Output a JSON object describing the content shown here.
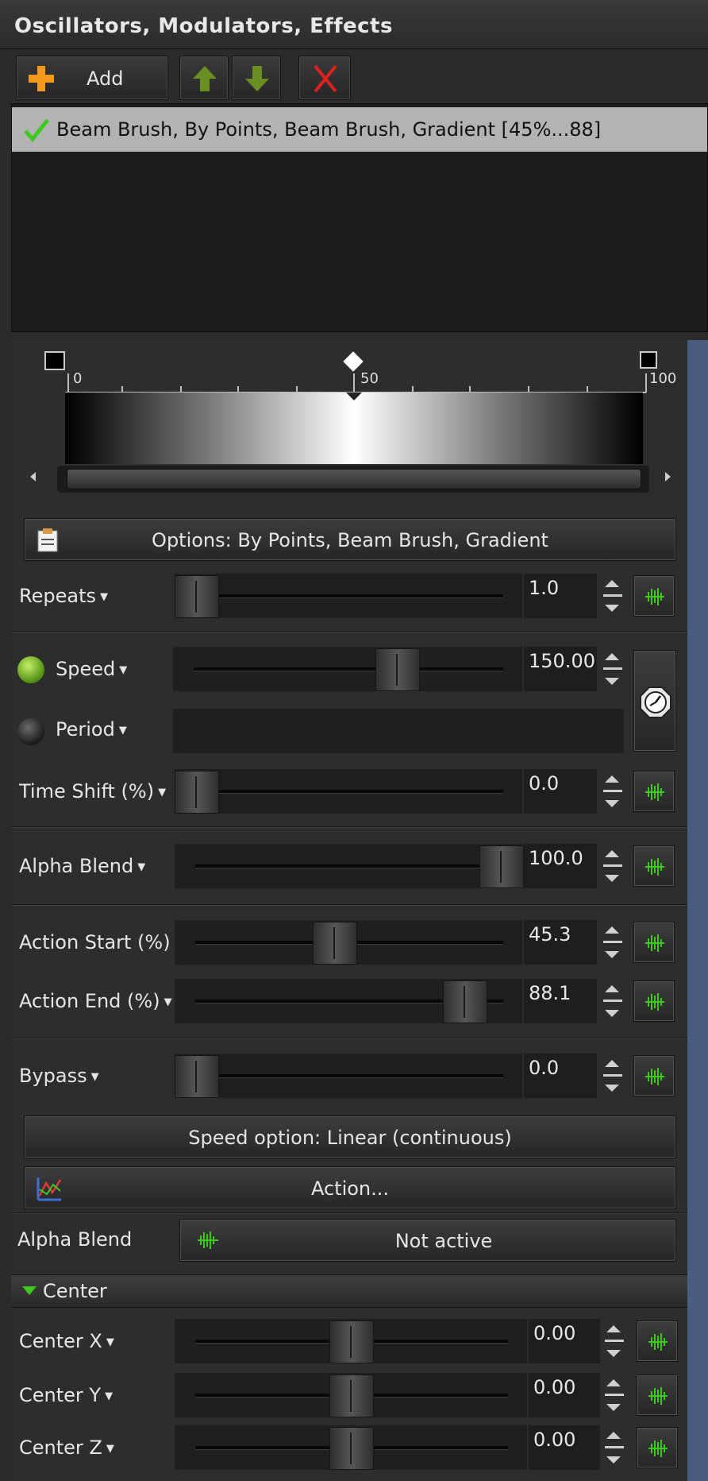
{
  "window": {
    "title": "Oscillators, Modulators, Effects"
  },
  "toolbar": {
    "add_label": "Add",
    "add_icon": "plus-icon",
    "up_icon": "arrow-up-icon",
    "down_icon": "arrow-down-icon",
    "delete_icon": "x-icon"
  },
  "list": {
    "items": [
      {
        "label": "Beam Brush, By Points, Beam Brush, Gradient [45%...88]",
        "checked": true
      }
    ]
  },
  "gradient": {
    "tick_start": "0",
    "tick_mid": "50",
    "tick_end": "100",
    "stops": [
      "#000000",
      "#ffffff",
      "#000000"
    ]
  },
  "options": {
    "label": "Options: By Points, Beam Brush, Gradient"
  },
  "params": {
    "repeats": {
      "label": "Repeats",
      "value": "1.0",
      "level": 0.0
    },
    "speed": {
      "label": "Speed",
      "value": "150.00",
      "level": 0.66,
      "active": true
    },
    "period": {
      "label": "Period",
      "active": false
    },
    "time_shift": {
      "label": "Time Shift (%)",
      "value": "0.0",
      "level": 0.0
    },
    "alpha_blend": {
      "label": "Alpha Blend",
      "value": "100.0",
      "level": 1.0
    },
    "action_start": {
      "label": "Action Start (%)",
      "value": "45.3",
      "level": 0.453
    },
    "action_end": {
      "label": "Action End (%)",
      "value": "88.1",
      "level": 0.881
    },
    "bypass": {
      "label": "Bypass",
      "value": "0.0",
      "level": 0.0
    }
  },
  "speed_option": {
    "label": "Speed option: Linear (continuous)"
  },
  "action": {
    "label": "Action..."
  },
  "alpha_blend_mod": {
    "label": "Alpha Blend",
    "status": "Not active"
  },
  "center": {
    "header": "Center",
    "x": {
      "label": "Center X",
      "value": "0.00",
      "level": 0.5
    },
    "y": {
      "label": "Center Y",
      "value": "0.00",
      "level": 0.5
    },
    "z": {
      "label": "Center Z",
      "value": "0.00",
      "level": 0.5
    }
  },
  "colors": {
    "accent_green": "#3cc81e",
    "list_selected": "#b3b3b3",
    "side_bar": "#4a5c80",
    "delete_red": "#e02020"
  }
}
